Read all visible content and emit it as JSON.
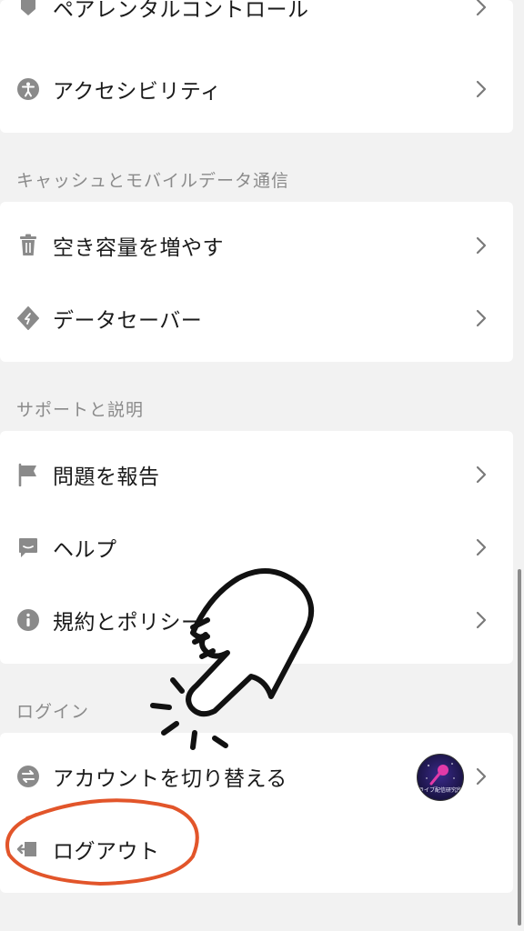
{
  "groups": {
    "top_partial_label": "ペアレンタルコントロール",
    "accessibility_label": "アクセシビリティ",
    "cache_section": {
      "title": "キャッシュとモバイルデータ通信",
      "items": [
        "空き容量を増やす",
        "データセーバー"
      ]
    },
    "support_section": {
      "title": "サポートと説明",
      "items": [
        "問題を報告",
        "ヘルプ",
        "規約とポリシー"
      ]
    },
    "login_section": {
      "title": "ログイン",
      "items": [
        "アカウントを切り替える",
        "ログアウト"
      ]
    }
  },
  "avatar": {
    "caption": "ライブ配信研究所"
  },
  "colors": {
    "background": "#f2f2f2",
    "card": "#ffffff",
    "icon": "#8a8a8a",
    "annotation": "#e2552a"
  }
}
